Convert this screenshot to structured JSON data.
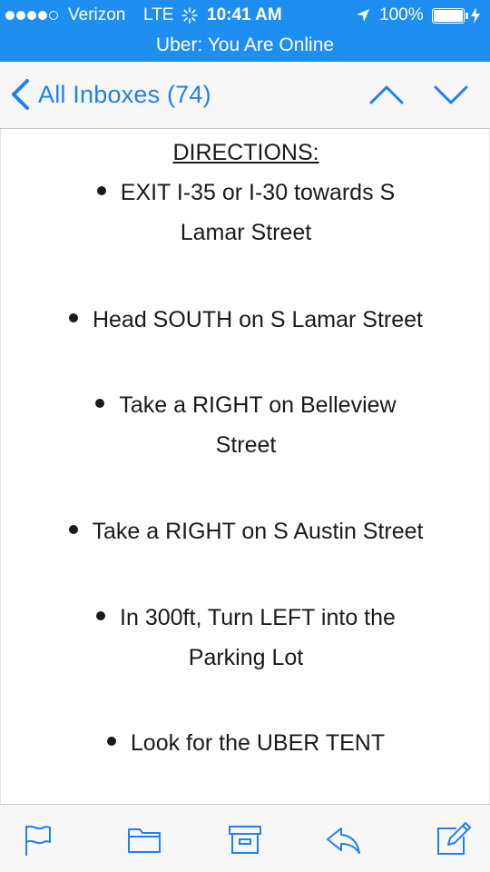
{
  "status_bar": {
    "carrier": "Verizon",
    "network": "LTE",
    "time": "10:41 AM",
    "battery": "100%",
    "banner": "Uber: You Are Online",
    "color": "#1f8ef1"
  },
  "nav": {
    "back_label": "All Inboxes (74)",
    "accent_color": "#1f7ff3",
    "icons": [
      "chevron-left-icon",
      "chevron-up-icon",
      "chevron-down-icon"
    ]
  },
  "email": {
    "heading": "DIRECTIONS:",
    "steps": [
      {
        "line1": "EXIT I-35 or I-30 towards S",
        "line2": "Lamar Street"
      },
      {
        "line1": "Head SOUTH on S Lamar Street",
        "line2": ""
      },
      {
        "line1": "Take a RIGHT on Belleview",
        "line2": "Street"
      },
      {
        "line1": "Take a RIGHT on S Austin Street",
        "line2": ""
      },
      {
        "line1": "In 300ft, Turn LEFT into the",
        "line2": "Parking Lot"
      },
      {
        "line1": "Look for the UBER TENT",
        "line2": ""
      }
    ]
  },
  "toolbar": {
    "icons": [
      "flag-icon",
      "folder-icon",
      "archive-icon",
      "reply-icon",
      "compose-icon"
    ]
  }
}
